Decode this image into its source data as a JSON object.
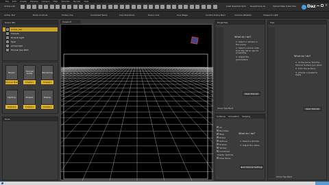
{
  "menu": [
    "File",
    "Edit",
    "Create",
    "Window",
    "Camera",
    "Help",
    "Tutorials",
    "Render",
    "Help"
  ],
  "brand": "Daz",
  "toolbar": {
    "left_label": "Active Lab",
    "right_labels": [
      "Load Selected Item",
      "Save/Scene As",
      "Upload New Subscribe"
    ],
    "row2": [
      "Active Tool",
      "Draw Controls",
      "Active Line",
      "Combined Items",
      "Line Directions",
      "Scene Line",
      "Line Stage",
      "Control Scene Navi",
      "Camera Rotation",
      "Viewport Light"
    ]
  },
  "left_panel": {
    "title": "Scene Tab",
    "scene_items": [
      "Active_Lab",
      "Camera",
      "Distant Light",
      "Spot",
      "Actual Cam",
      "Tutorial Gen Path"
    ],
    "thumbs": [
      {
        "label": "Basics",
        "caption": "Tutorial Basic"
      },
      {
        "label": "Tutorial Guide",
        "caption": "Shaders"
      },
      {
        "label": "Rendering",
        "caption": "Shaders"
      },
      {
        "label": "Lighting",
        "caption": "Shaders"
      },
      {
        "label": "Shapes",
        "caption": "Shaders"
      },
      {
        "label": "Posing",
        "caption": "Shaders"
      }
    ],
    "lower_title": "Tools"
  },
  "viewport": {
    "tab": "Viewport"
  },
  "tips_panel": {
    "title": "Properties",
    "heading": "What do I do?",
    "steps": [
      "1. Select a camera in the scene.",
      "2. Select a scene node from the list to see its properties.",
      "3. Adjust the parameters."
    ],
    "button": "Next Tutorial",
    "footer_check": "Show Tips Next"
  },
  "lower_panel": {
    "tabs": [
      "Surfaces",
      "Simulation",
      "Shaping"
    ],
    "list": [
      "All",
      "Favorites",
      "Fiber",
      "Drape",
      "Options",
      "Drapes",
      "Stickey",
      "Combined",
      "Shader Options",
      "Pose Items"
    ],
    "heading": "What do I do?",
    "steps": [
      "1. Select a wrinkle.",
      "2. Adjust the value."
    ],
    "button": "Next Tutorial Settings"
  },
  "right_panel": {
    "title": "Tips",
    "heading": "What do I do?",
    "steps": [
      "1. In the panel, find the Tutorial Surface you want.",
      "2. Click the surface.",
      "3. Choose a preset to apply."
    ],
    "button": "Next Tutorial",
    "footer_check": "Show Tips Next"
  }
}
